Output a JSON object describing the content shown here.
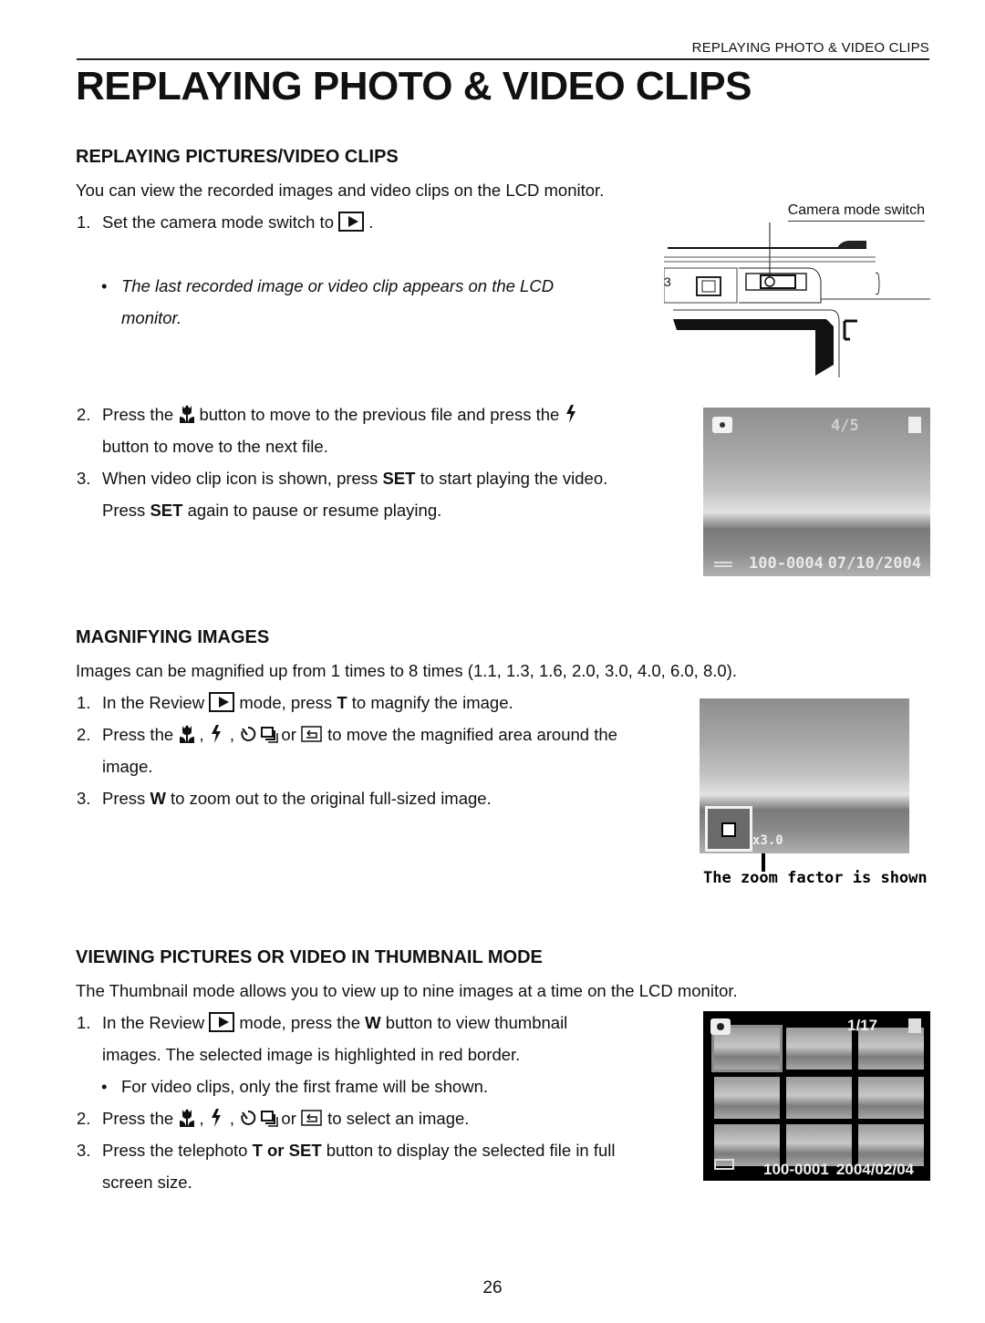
{
  "running_head": "REPLAYING PHOTO & VIDEO CLIPS",
  "page_title": "REPLAYING PHOTO & VIDEO CLIPS",
  "sections": {
    "replaying": {
      "heading": "REPLAYING PICTURES/VIDEO CLIPS",
      "intro": "You can view the recorded images and video clips on the LCD monitor.",
      "step1_num": "1.",
      "step1_text": "Set the camera mode switch to",
      "step1_end": ".",
      "note_bullet": "•",
      "note_line1": "The last recorded image or video clip appears on the LCD",
      "note_line2": "monitor.",
      "step2_num": "2.",
      "step2_a": "Press the",
      "step2_b": "button to move to the previous file and press the",
      "step2_c": "button to move to the next file.",
      "step3_num": "3.",
      "step3_a": "When video clip icon is shown, press",
      "step3_bold1": "SET",
      "step3_b": "to start playing the video.",
      "step3_c": "Press",
      "step3_bold2": "SET",
      "step3_d": "again to pause or resume playing.",
      "figure_camera_label": "Camera mode switch",
      "figure_lcd": {
        "counter": "4/5",
        "file_no": "100-0004",
        "date": "07/10/2004"
      }
    },
    "magnify": {
      "heading": "MAGNIFYING IMAGES",
      "intro": "Images can be magnified up from 1 times to 8 times (1.1, 1.3, 1.6, 2.0, 3.0, 4.0, 6.0, 8.0).",
      "step1_num": "1.",
      "step1_a": "In the Review",
      "step1_b": "mode, press",
      "step1_bold": "T",
      "step1_c": "to magnify the image.",
      "step2_num": "2.",
      "step2_a": "Press the",
      "comma": ",",
      "or": "or",
      "step2_b": "to move the magnified area around the",
      "step2_c": "image.",
      "step3_num": "3.",
      "step3_a": "Press",
      "step3_bold": "W",
      "step3_b": "to zoom out to the original full-sized image.",
      "figure_zoom_factor": "x3.0",
      "figure_caption": "The zoom factor is shown"
    },
    "thumbnail": {
      "heading": "VIEWING PICTURES OR VIDEO IN THUMBNAIL MODE",
      "intro": "The Thumbnail mode allows you to view up to nine images at a time on the LCD monitor.",
      "step1_num": "1.",
      "step1_a": "In the Review",
      "step1_b": "mode, press the",
      "step1_bold": "W",
      "step1_c": "button to view thumbnail",
      "step1_d": "images. The selected image is highlighted in red border.",
      "note_bullet": "•",
      "note": "For video clips, only the first frame will be shown.",
      "step2_num": "2.",
      "step2_a": "Press the",
      "comma": ",",
      "or": "or",
      "step2_b": "to select an image.",
      "step3_num": "3.",
      "step3_a": "Press the telephoto",
      "step3_bold": "T or SET",
      "step3_b": "button to display the selected file in full",
      "step3_c": "screen size.",
      "figure_thumb": {
        "counter": "1/17",
        "file_no": "100-0001",
        "date": "2004/02/04",
        "thumb_count": 9
      }
    }
  },
  "icons": {
    "playback": "playback-mode-icon",
    "macro": "macro-tulip-icon",
    "flash": "flash-icon",
    "self_timer": "self-timer-icon",
    "continuous": "continuous-shot-icon",
    "return": "return-icon"
  },
  "page_number": "26"
}
